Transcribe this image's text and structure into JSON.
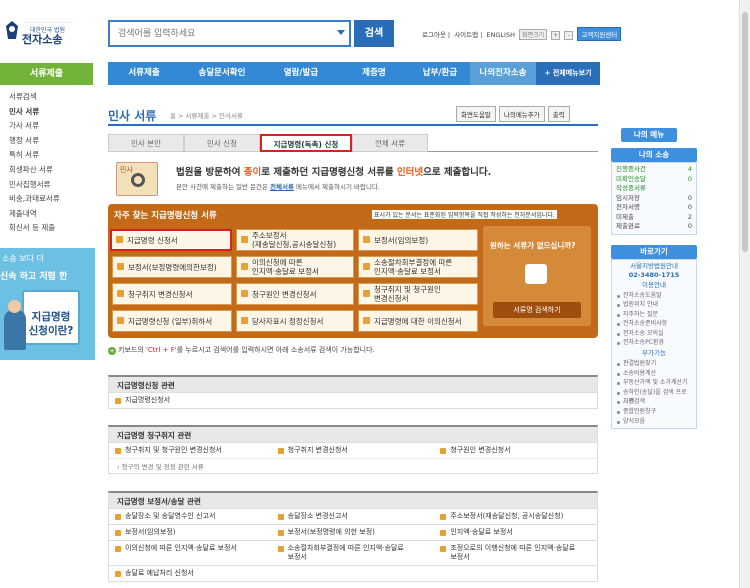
{
  "header": {
    "logo_sub": "대한민국 법원",
    "logo_main": "전자소송",
    "search_placeholder": "검색어를 입력하세요",
    "search_button": "검색",
    "links": [
      "로그아웃",
      "|",
      "사이트맵",
      "|",
      "ENGLISH"
    ],
    "font_box": "화면크기",
    "font_plus": "+",
    "font_minus": "-",
    "cc_button": "고객지원센터"
  },
  "gnb": {
    "items": [
      "서류제출",
      "송달문서확인",
      "열람/발급",
      "제증명",
      "납부/환급",
      "나의전자소송"
    ],
    "all": "+ 전체메뉴보기"
  },
  "lnb": {
    "title": "서류제출",
    "items": [
      "서류검색",
      "민사 서류",
      "가사 서류",
      "행정 서류",
      "특허 서류",
      "회생파산 서류",
      "민사집행서류",
      "비송,과태료서류",
      "제출내역",
      "회신서 등 제출"
    ]
  },
  "promo": {
    "line1": "소송 보다 더",
    "line2": "신속 하고 저렴 한",
    "doc_title1": "지급명령",
    "doc_title2": "신청이란?"
  },
  "page": {
    "title": "민사 서류",
    "breadcrumb": "홈 > 서류제출 > 민사서류",
    "buttons": [
      "화면도움말",
      "나의메뉴추가",
      "출력"
    ]
  },
  "tabs": [
    "민사 본안",
    "민사 신청",
    "지급명령(독촉) 신청",
    "전체 서류"
  ],
  "intro": {
    "icon_label": "민사",
    "line1_a": "법원을 방문하여 ",
    "line1_b": "종이",
    "line1_c": "로 제출하던 지급명령신청 서류를 ",
    "line1_d": "인터넷",
    "line1_e": "으로 제출합니다.",
    "line2_a": "본안 사건에 제출하는 일반 문건은 ",
    "line2_b": "전체서류",
    "line2_c": " 메뉴에서 제출하시기 바랍니다."
  },
  "favorites": {
    "title": "자주 찾는 지급명령신청 서류",
    "note": "표시가 있는 문서는 표준화된 입력항목을 직접 작성하는 전자문서입니다.",
    "items": [
      "지급명령 신청서",
      "주소보정서\n(재송달신청,공시송달신청)",
      "보정서(임의보정)",
      "보정서(보정명령에의한보정)",
      "이의신청에 따른\n인지액·송달료 보정서",
      "소송절차회부결정에 따른\n인지액·송달료 보정서",
      "청구취지 변경신청서",
      "청구원인 변경신청서",
      "청구취지 및 청구원인\n변경신청서",
      "지급명령신청 (일부)취하서",
      "당사자표시 정정신청서",
      "지급명령에 대한 이의신청서"
    ],
    "ask_q": "원하는 서류가 없으십니까?",
    "ask_btn": "서류명 검색하기"
  },
  "hint": {
    "dot": "+",
    "a": "키보드의 ",
    "b": "'Ctrl + F'",
    "c": "를 누르시고 검색어를 입력하시면 아래 소송서류 검색이 가능합니다."
  },
  "sections": [
    {
      "title": "지급명령신청 관련",
      "rows": [
        [
          "지급명령신청서",
          "",
          ""
        ]
      ]
    },
    {
      "title": "지급명령 청구취지 관련",
      "rows": [
        [
          "청구취지 및 청구원인 변경신청서",
          "청구취지 변경신청서",
          "청구원인 변경신청서"
        ]
      ],
      "sub": "› 청구의 변경 및 정정 관련 서류"
    },
    {
      "title": "지급명령 보정서/송달 관련",
      "rows": [
        [
          "송달장소 및 송달영수인 신고서",
          "송달장소 변경신고서",
          "주소보정서(재송달신청, 공시송달신청)"
        ],
        [
          "보정서(임의보정)",
          "보정서(보정명령에 의한 보정)",
          "인지액·송달료 보정서"
        ],
        [
          "이의신청에 따른 인지액·송달료 보정서",
          "소송절차회부결정에 따른 인지액·송달료\n보정서",
          "조정으로의 이행신청에 따른 인지액·송달료\n보정서"
        ],
        [
          "송달료 예납처리 신청서",
          "",
          ""
        ]
      ]
    }
  ],
  "right": {
    "my_title": "나의 메뉴",
    "case_title": "나의 소송",
    "case_rows": [
      [
        "진행중사건",
        "4"
      ],
      [
        "미확인송달",
        "0"
      ],
      [
        "작성중서류",
        ""
      ],
      [
        "임시저장",
        "0"
      ],
      [
        "전자서명",
        "0"
      ],
      [
        "미제출",
        "2"
      ],
      [
        "제출완료",
        "0"
      ]
    ],
    "shortcut_title": "바로가기",
    "support_name": "서울지방법원안내",
    "tel": "02-3480-1715",
    "guide_title": "이용안내",
    "links1": [
      "전자소송도움말",
      "법원위치 안내",
      "자주하는 질문",
      "전자소송준비사항",
      "전자소송 모의실",
      "전자소송PC환경"
    ],
    "tools_title": "부가기능",
    "links2": [
      "판결법원찾기",
      "소송비용계산",
      "부동산가액 및 소가계산기",
      "송하인(송달)을 검색 프로그램",
      "사건검색",
      "종합민원창구",
      "양식모음"
    ]
  }
}
